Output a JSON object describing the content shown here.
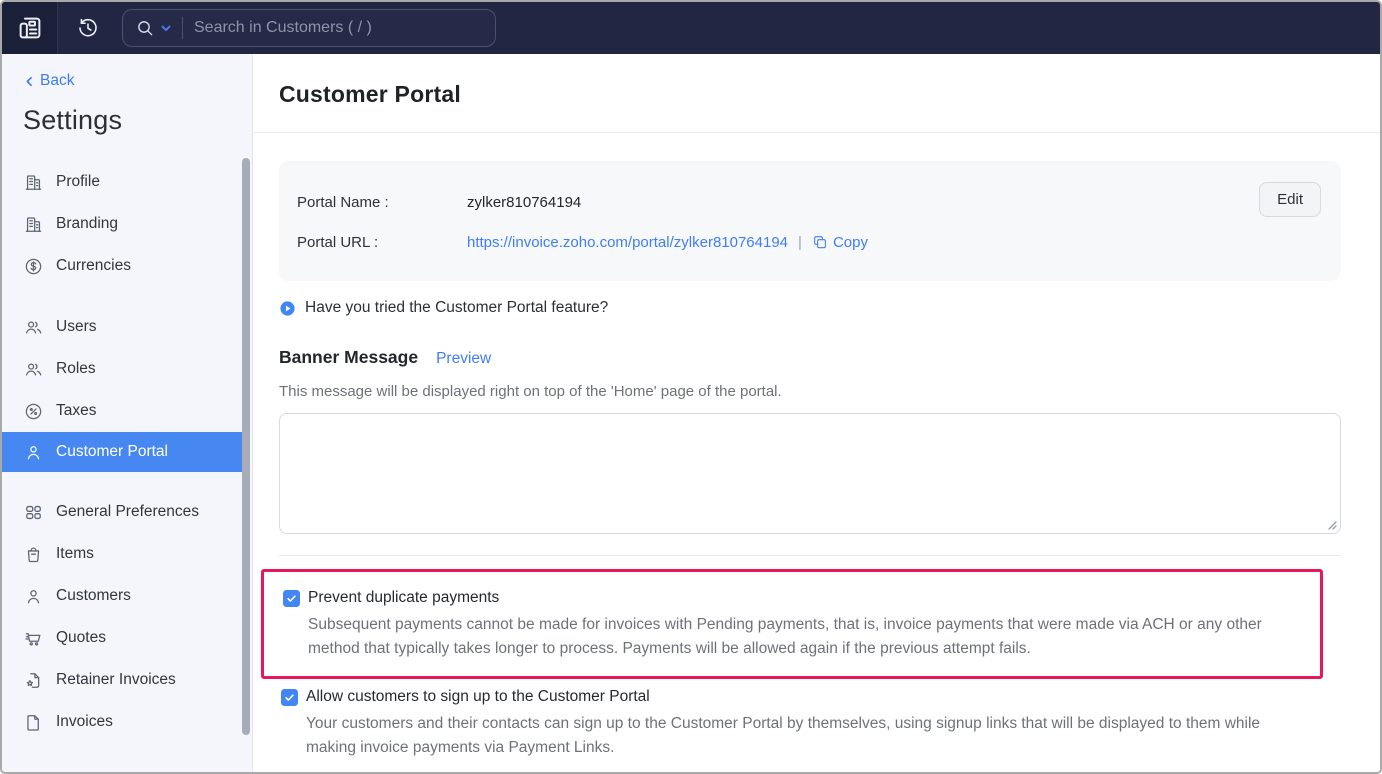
{
  "topbar": {
    "search_placeholder": "Search in Customers ( / )"
  },
  "sidebar": {
    "back_label": "Back",
    "title": "Settings",
    "items": [
      {
        "icon": "building-icon",
        "label": "Profile"
      },
      {
        "icon": "building-icon",
        "label": "Branding"
      },
      {
        "icon": "dollar-circle-icon",
        "label": "Currencies"
      },
      {
        "icon": "users-icon",
        "label": "Users"
      },
      {
        "icon": "users-icon",
        "label": "Roles"
      },
      {
        "icon": "percent-circle-icon",
        "label": "Taxes"
      },
      {
        "icon": "person-icon",
        "label": "Customer Portal",
        "selected": true
      },
      {
        "icon": "grid-icon",
        "label": "General Preferences"
      },
      {
        "icon": "bag-icon",
        "label": "Items"
      },
      {
        "icon": "person-icon",
        "label": "Customers"
      },
      {
        "icon": "cart-icon",
        "label": "Quotes"
      },
      {
        "icon": "document-star-icon",
        "label": "Retainer Invoices"
      },
      {
        "icon": "document-icon",
        "label": "Invoices"
      }
    ]
  },
  "main": {
    "title": "Customer Portal",
    "portal": {
      "name_label": "Portal Name :",
      "name_value": "zylker810764194",
      "url_label": "Portal URL :",
      "url_value": "https://invoice.zoho.com/portal/zylker810764194",
      "separator": "|",
      "copy_label": "Copy",
      "edit_label": "Edit"
    },
    "feature_question": "Have you tried the Customer Portal feature?",
    "banner": {
      "heading": "Banner Message",
      "preview_label": "Preview",
      "description": "This message will be displayed right on top of the 'Home' page of the portal.",
      "value": ""
    },
    "options": [
      {
        "checked": true,
        "highlighted": true,
        "label": "Prevent duplicate payments",
        "description": "Subsequent payments cannot be made for invoices with Pending payments, that is, invoice payments that were made via ACH or any other method that typically takes longer to process. Payments will be allowed again if the previous attempt fails."
      },
      {
        "checked": true,
        "highlighted": false,
        "label": "Allow customers to sign up to the Customer Portal",
        "description": "Your customers and their contacts can sign up to the Customer Portal by themselves, using signup links that will be displayed to them while making invoice payments via Payment Links."
      }
    ]
  },
  "colors": {
    "navbar_bg": "#212742",
    "sidebar_bg": "#f4f6fb",
    "selected_item_bg": "#4687f2",
    "accent_blue": "#4285f4",
    "link_blue": "#3f7ef7",
    "highlight_border": "#e6175c",
    "muted_text": "#6e7278"
  }
}
